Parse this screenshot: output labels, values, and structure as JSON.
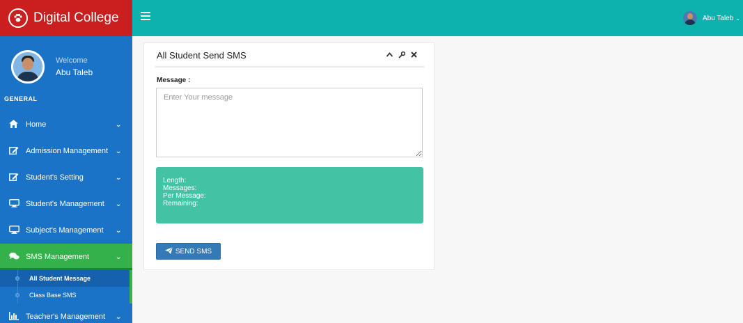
{
  "brand": {
    "name": "Digital College",
    "logo_icon": "paw-icon"
  },
  "profile": {
    "welcome": "Welcome",
    "name": "Abu Taleb"
  },
  "sidebar": {
    "section_title": "GENERAL",
    "items": [
      {
        "label": "Home",
        "icon": "home-icon"
      },
      {
        "label": "Admission Management",
        "icon": "edit-icon"
      },
      {
        "label": "Student's Setting",
        "icon": "edit-icon"
      },
      {
        "label": "Student's Management",
        "icon": "desktop-icon"
      },
      {
        "label": "Subject's Management",
        "icon": "desktop-icon"
      },
      {
        "label": "SMS Management",
        "icon": "comments-icon",
        "active": true
      },
      {
        "label": "Teacher's Management",
        "icon": "bar-chart-icon"
      }
    ],
    "submenu": [
      {
        "label": "All Student Message",
        "active": true
      },
      {
        "label": "Class Base SMS"
      }
    ]
  },
  "topbar": {
    "user_name": "Abu Taleb"
  },
  "panel": {
    "title": "All Student Send SMS",
    "message_label": "Message :",
    "message_placeholder": "Enter Your message",
    "stats": {
      "length_label": "Length:",
      "messages_label": "Messages:",
      "per_message_label": "Per Message:",
      "remaining_label": "Remaining:"
    },
    "send_button": "SEND SMS"
  },
  "colors": {
    "brand_red": "#c9201f",
    "sidebar_blue": "#1a73c6",
    "topbar_teal": "#0db2ae",
    "active_green": "#34b14a",
    "stats_green": "#43c3a4",
    "button_blue": "#337ab7"
  }
}
